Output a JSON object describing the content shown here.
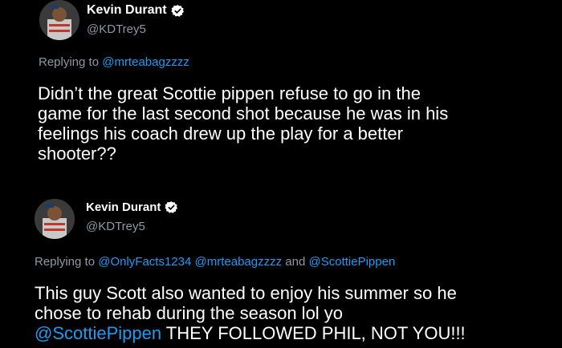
{
  "colors": {
    "background": "#000000",
    "text": "#ffffff",
    "secondary": "#8b98a5",
    "mention": "#1d9bf0",
    "verified": "#ffffff"
  },
  "tweets": [
    {
      "name": "Kevin Durant",
      "handle": "@KDTrey5",
      "verified_icon": "verified-badge-icon",
      "reply_prefix": "Replying to ",
      "reply_mentions": [
        "@mrteabagzzzz"
      ],
      "body_lines": [
        "Didn’t the great Scottie pippen refuse to go in the",
        "game for the last second shot because he was in his",
        "feelings his coach drew up the play for a better",
        "shooter??"
      ]
    },
    {
      "name": "Kevin Durant",
      "handle": "@KDTrey5",
      "verified_icon": "verified-badge-icon",
      "reply_prefix": "Replying to ",
      "reply_mentions": [
        "@OnlyFacts1234",
        "@mrteabagzzzz",
        "@ScottiePippen"
      ],
      "reply_joiners": [
        " ",
        " and "
      ],
      "body_lines": [
        "This guy Scott also wanted to enjoy his summer so he",
        "chose to rehab during the season lol yo"
      ],
      "body_mention": "@ScottiePippen",
      "body_tail": " THEY FOLLOWED PHIL, NOT YOU!!!"
    }
  ]
}
